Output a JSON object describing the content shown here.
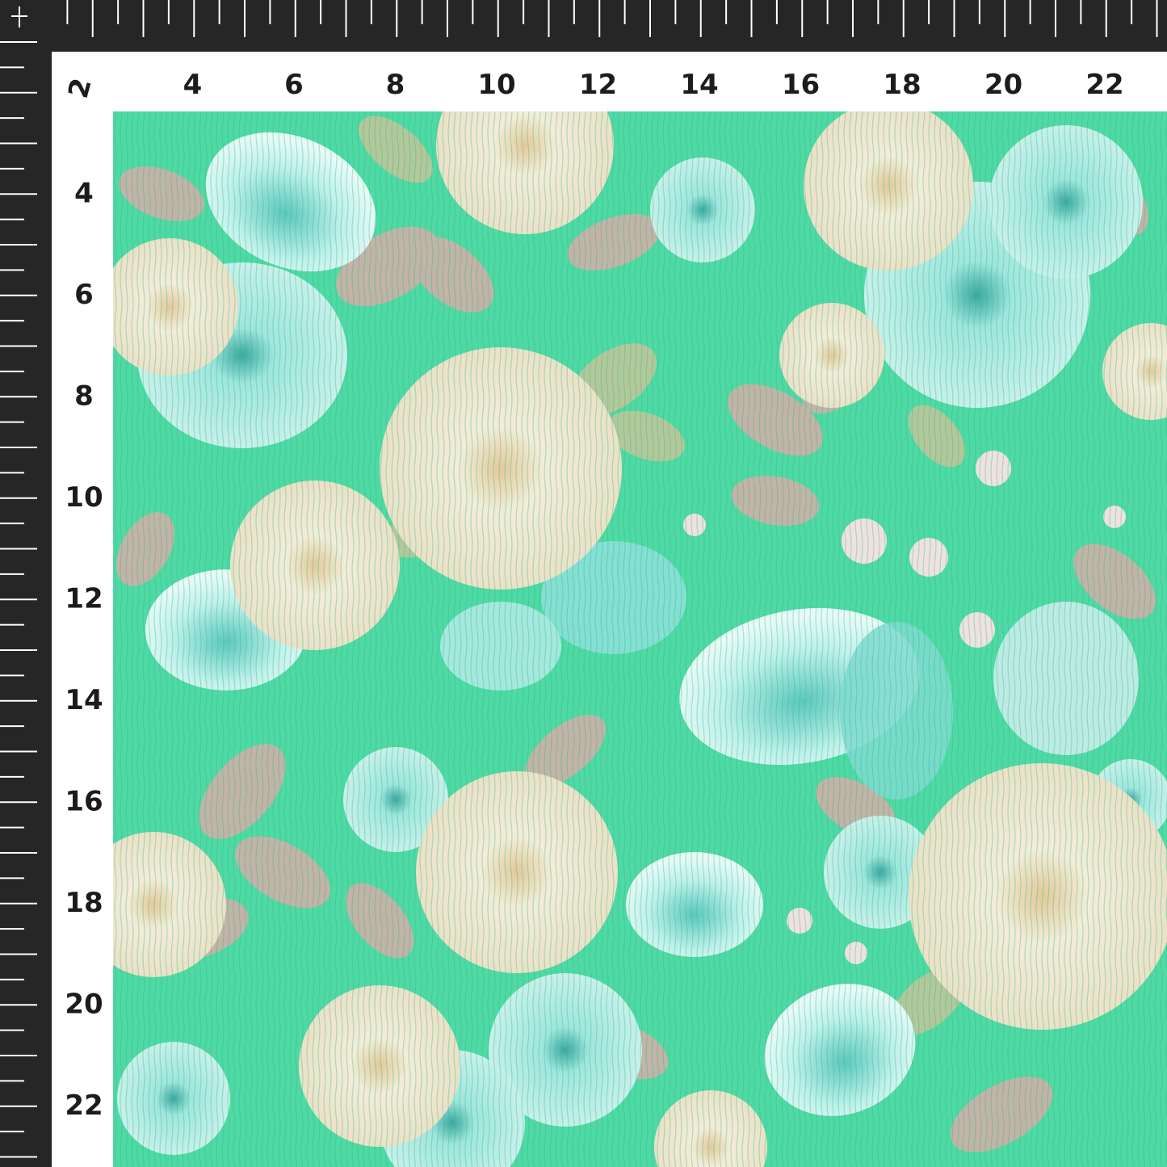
{
  "ruler": {
    "top_numbers": [
      "4",
      "6",
      "8",
      "10",
      "12",
      "14",
      "16",
      "18",
      "20",
      "22"
    ],
    "left_numbers": [
      "4",
      "6",
      "8",
      "10",
      "12",
      "14",
      "16",
      "18",
      "20",
      "22"
    ],
    "corner_number": "2"
  },
  "colors": {
    "ruler": "#262626",
    "fabric_ground": "#4fd9a4",
    "rose_cream": "#f1ead6",
    "flower_aqua": "#8fe2d6",
    "leaf_taupe": "#c9b3a8",
    "leaf_sage": "#b9c89a"
  },
  "fabric": {
    "pattern": "cream roses, aqua dahlias and tulips with taupe leaves on mint green crinkled chiffon"
  }
}
